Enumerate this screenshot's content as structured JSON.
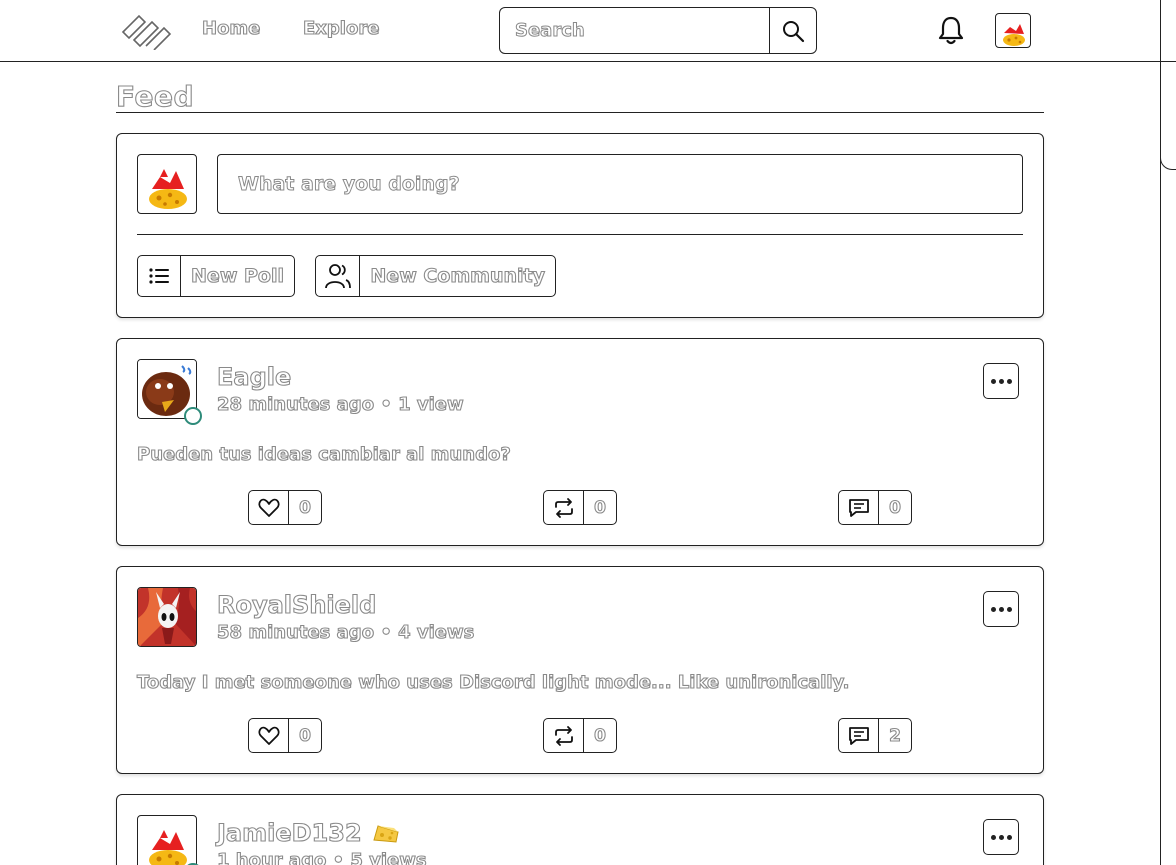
{
  "nav": {
    "home": "Home",
    "explore": "Explore",
    "search_placeholder": "Search"
  },
  "feed": {
    "title": "Feed",
    "composer": {
      "placeholder": "What are you doing?",
      "new_poll": "New Poll",
      "new_community": "New Community"
    }
  },
  "posts": [
    {
      "author": "Eagle",
      "meta": "28 minutes ago • 1 view",
      "text": "Pueden tus ideas cambiar al mundo?",
      "likes": "0",
      "reposts": "0",
      "comments": "0",
      "online": true
    },
    {
      "author": "RoyalShield",
      "meta": "58 minutes ago • 4 views",
      "text": "Today I met someone who uses Discord light mode... Like unironically.",
      "likes": "0",
      "reposts": "0",
      "comments": "2",
      "online": false
    },
    {
      "author": "JamieD132",
      "meta": "1 hour ago • 5 views",
      "badge": "cheese-icon",
      "online": true
    }
  ],
  "colors": {
    "border": "#222222",
    "text_outline": "#8a8a8a",
    "online": "#2e8b7a"
  }
}
